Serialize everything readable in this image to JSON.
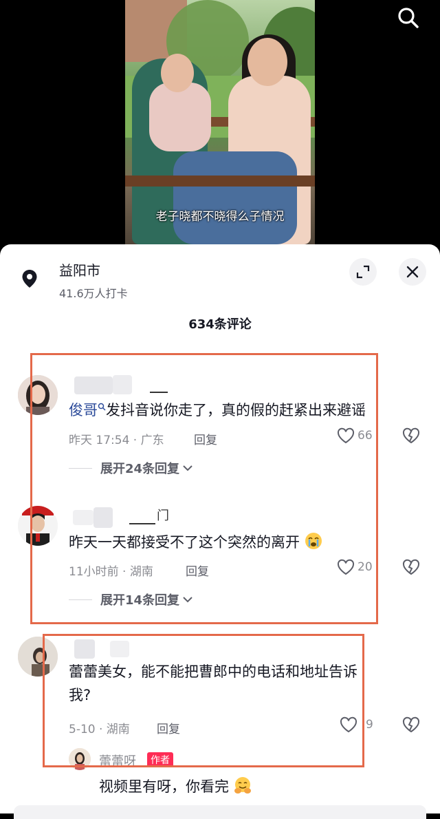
{
  "video": {
    "caption": "老子晓都不晓得么子情况"
  },
  "location": {
    "name": "益阳市",
    "checkins": "41.6万人打卡"
  },
  "comments_header": {
    "count_label": "634条评论"
  },
  "comments": [
    {
      "mention": "俊哥",
      "text": "发抖音说你走了，真的假的赶紧出来避谣",
      "meta": "昨天 17:54 · 广东",
      "reply_label": "回复",
      "likes": "66",
      "expand_label": "展开24条回复"
    },
    {
      "text": "昨天一天都接受不了这个突然的离开",
      "name_fragment": "门",
      "meta": "11小时前 · 湖南",
      "reply_label": "回复",
      "likes": "20",
      "expand_label": "展开14条回复"
    },
    {
      "text_line1": "蕾蕾美女，能不能把曹郎中的电话和地址告诉",
      "text_line2": "我?",
      "meta": "5-10 · 湖南",
      "reply_label": "回复",
      "likes": "9"
    }
  ],
  "author_reply": {
    "name": "蕾蕾呀",
    "tag": "作者",
    "text": "视频里有呀，你看完"
  },
  "icons": {
    "search": "search-icon",
    "location": "location-pin-icon",
    "expand": "expand-icon",
    "close": "close-icon",
    "like": "heart-icon",
    "dislike": "broken-heart-icon",
    "crying_emoji": "crying-face-icon",
    "hugging_emoji": "hugging-face-icon"
  },
  "colors": {
    "highlight": "#e4694a",
    "author_tag": "#fe2c55",
    "mention": "#2c4b9a"
  }
}
